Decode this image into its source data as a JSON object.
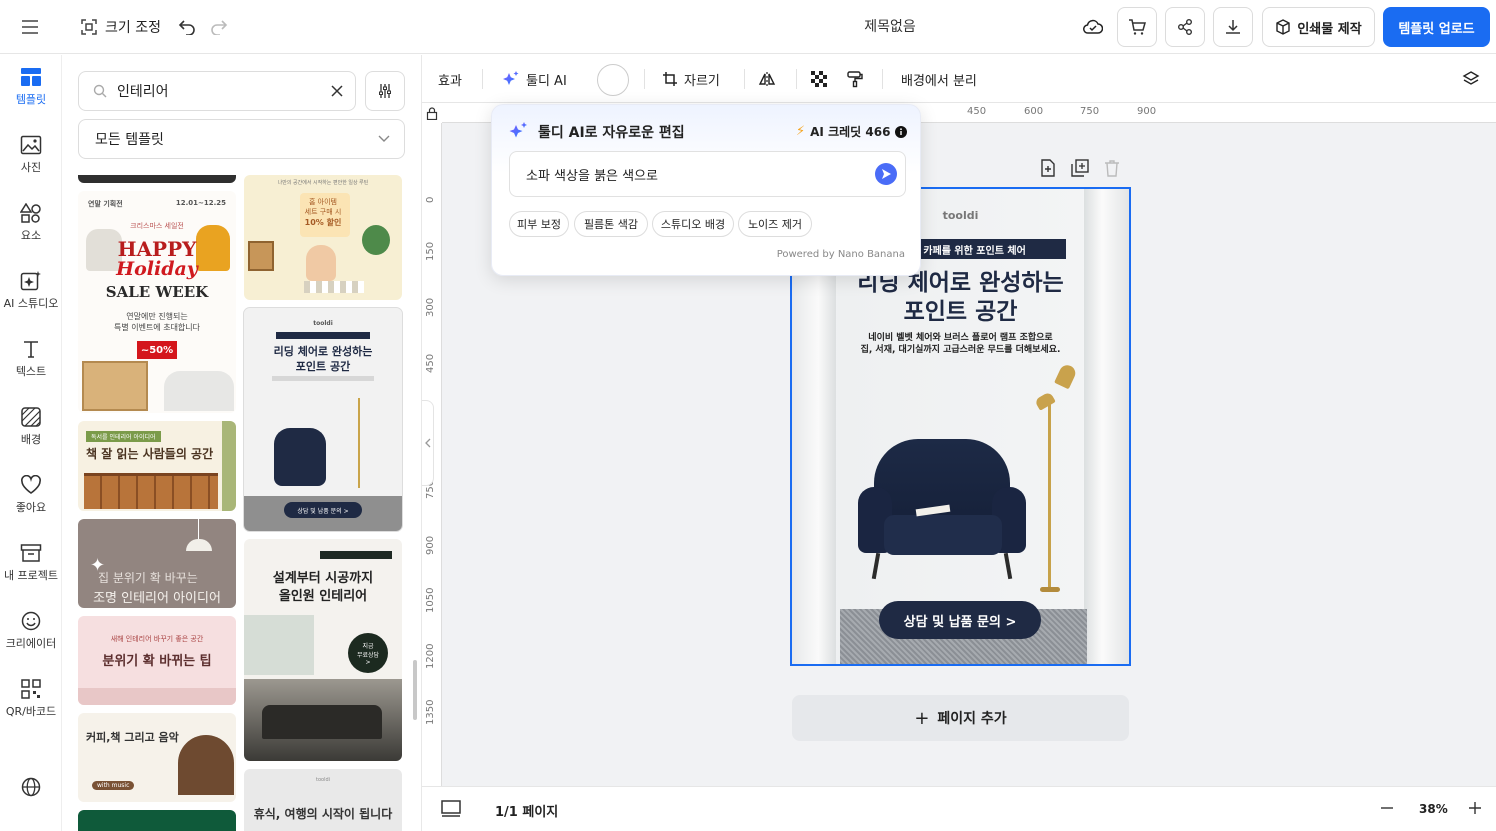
{
  "topbar": {
    "resize_label": "크기 조정",
    "doc_title": "제목없음",
    "print_label": "인쇄물 제작",
    "upload_label": "템플릿 업로드"
  },
  "rail": {
    "items": [
      {
        "label": "템플릿",
        "icon": "template-icon"
      },
      {
        "label": "사진",
        "icon": "photo-icon"
      },
      {
        "label": "요소",
        "icon": "shapes-icon"
      },
      {
        "label": "AI 스튜디오",
        "icon": "ai-sparkle-icon"
      },
      {
        "label": "텍스트",
        "icon": "text-icon"
      },
      {
        "label": "배경",
        "icon": "background-icon"
      },
      {
        "label": "좋아요",
        "icon": "heart-icon"
      },
      {
        "label": "내 프로젝트",
        "icon": "box-icon"
      },
      {
        "label": "크리에이터",
        "icon": "smile-icon"
      },
      {
        "label": "QR/바코드",
        "icon": "qr-icon"
      }
    ]
  },
  "panel": {
    "search_value": "인테리어",
    "category": "모든 템플릿",
    "thumbs": [
      {
        "l1": "연말 기획전",
        "l2": "12.01~12.25",
        "l3": "크리스마스 세일전",
        "l4": "HAPPY",
        "l5": "Holiday",
        "l6": "SALE WEEK",
        "l7": "연말에만 진행되는",
        "l8": "특별 이벤트에 초대합니다",
        "l9": "~50%"
      },
      {
        "l1": "나만의 공간에서 시작하는 편안한 일상 루틴",
        "l2": "홈 아이템",
        "l3": "세트 구매 시",
        "l4": "10% 할인"
      },
      {
        "l1": "독서를 인테리어 아이디어",
        "l2": "책 잘 읽는 사람들의 공간"
      },
      {
        "l1": "tooldi",
        "l2": "리딩 체어로 완성하는",
        "l3": "포인트 공간",
        "l4": "상담 및 납품 문의 >"
      },
      {
        "l1": "집 분위기 확 바꾸는",
        "l2": "조명 인테리어 아이디어"
      },
      {
        "l1": "설계부터 시공까지",
        "l2": "올인원 인테리어",
        "l3": "지금",
        "l4": "무료상담",
        "l5": ">"
      },
      {
        "l1": "새해 인테리어 바꾸기 좋은 공간",
        "l2": "분위기 확 바뀌는 팁"
      },
      {
        "l1": "커피,책 그리고 음악",
        "l2": "with music"
      },
      {
        "l1": "휴식, 여행의 시작이 됩니다"
      }
    ]
  },
  "toolbar": {
    "effects": "효과",
    "ai": "툴디 AI",
    "crop": "자르기",
    "bg_remove": "배경에서 분리"
  },
  "ruler": {
    "top": [
      "450",
      "600",
      "750",
      "900"
    ],
    "left": [
      "0",
      "150",
      "300",
      "450",
      "750",
      "900",
      "1050",
      "1200",
      "1350"
    ]
  },
  "ai_popup": {
    "title": "툴디 AI로 자유로운 편집",
    "credit": "AI 크레딧 466",
    "input_value": "소파 색상을 붉은 색으로",
    "chips": [
      "피부 보정",
      "필름톤 색감",
      "스튜디오 배경",
      "노이즈 제거"
    ],
    "powered": "Powered by Nano Banana"
  },
  "artboard": {
    "brand": "tooldi",
    "banner": "서재 · 카페를 위한 포인트 체어",
    "headline1": "리딩 체어로 완성하는",
    "headline2": "포인트 공간",
    "desc1": "네이비 벨벳 체어와 브러스 플로어 램프 조합으로",
    "desc2": "집, 서재, 대기실까지 고급스러운 무드를 더해보세요.",
    "cta": "상담 및 납품 문의 >"
  },
  "canvas": {
    "add_page": "페이지 추가",
    "page_count": "1/1 페이지",
    "zoom": "38%"
  },
  "colors": {
    "accent": "#1a6cf2",
    "navy": "#1f2a44"
  }
}
